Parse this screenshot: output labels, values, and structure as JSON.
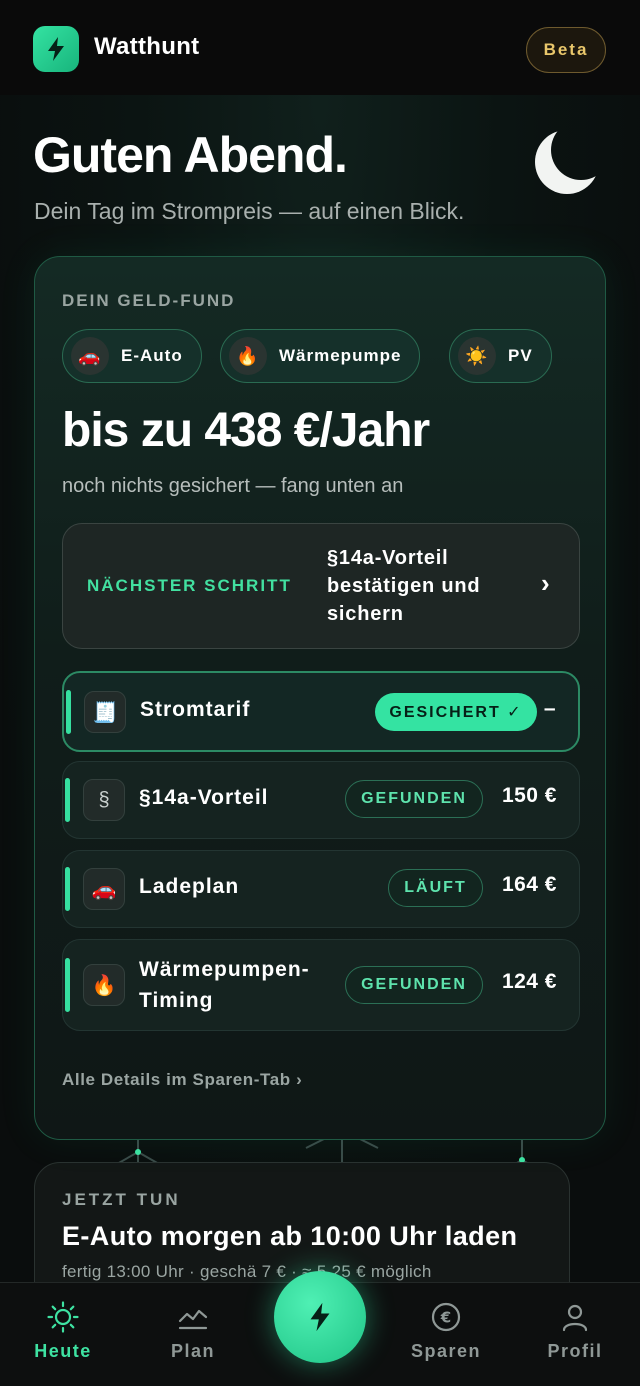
{
  "header": {
    "app_name": "Watthunt",
    "beta_label": "Beta"
  },
  "greeting": {
    "title": "Guten Abend.",
    "subtitle": "Dein Tag im Strompreis — auf einen Blick."
  },
  "money_card": {
    "eyebrow": "DEIN GELD-FUND",
    "chips": [
      {
        "icon": "car-icon",
        "label": "E-Auto"
      },
      {
        "icon": "flame-icon",
        "label": "Wärmepumpe"
      },
      {
        "icon": "sun-icon",
        "label": "PV"
      }
    ],
    "amount": "bis zu 438 €/Jahr",
    "amount_sub": "noch nichts gesichert — fang unten an",
    "next_step": {
      "label": "NÄCHSTER SCHRITT",
      "text": "§14a-Vorteil bestätigen und sichern"
    },
    "rows": [
      {
        "icon": "receipt-icon",
        "label": "Stromtarif",
        "badge": "GESICHERT ✓",
        "value": "–"
      },
      {
        "icon": "paragraph-icon",
        "label": "§14a-Vorteil",
        "badge": "GEFUNDEN",
        "value": "150 €"
      },
      {
        "icon": "car-icon",
        "label": "Ladeplan",
        "badge": "LÄUFT",
        "value": "164 €"
      },
      {
        "icon": "flame-icon",
        "label": "Wärmepumpen-Timing",
        "badge": "GEFUNDEN",
        "value": "124 €"
      }
    ],
    "details_link": "Alle Details im Sparen-Tab ›"
  },
  "action_card": {
    "eyebrow": "JETZT TUN",
    "title": "E-Auto morgen ab 10:00 Uhr laden",
    "subtitle": "fertig 13:00 Uhr · geschä   7 € · ≈ 5,25 € möglich"
  },
  "bottom_nav": {
    "items": [
      {
        "icon": "sun-icon",
        "label": "Heute"
      },
      {
        "icon": "chart-icon",
        "label": "Plan"
      },
      {
        "icon": "euro-icon",
        "label": "Sparen"
      },
      {
        "icon": "user-icon",
        "label": "Profil"
      }
    ]
  },
  "colors": {
    "accent": "#34e3a2",
    "beta_gold": "#e9c76b",
    "background": "#0b0d0d"
  }
}
